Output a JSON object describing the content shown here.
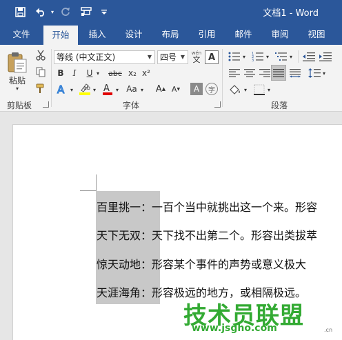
{
  "window": {
    "title": "文档1 - Word"
  },
  "quick_access": {
    "save_icon": "save-icon",
    "undo_icon": "undo-icon",
    "redo_icon": "redo-icon",
    "touch_mode_icon": "touch-mode-icon",
    "customize_icon": "customize-icon"
  },
  "tabs": [
    {
      "label": "文件"
    },
    {
      "label": "开始"
    },
    {
      "label": "插入"
    },
    {
      "label": "设计"
    },
    {
      "label": "布局"
    },
    {
      "label": "引用"
    },
    {
      "label": "邮件"
    },
    {
      "label": "审阅"
    },
    {
      "label": "视图"
    }
  ],
  "active_tab": "开始",
  "ribbon": {
    "clipboard": {
      "paste_label": "粘贴",
      "group_label": "剪贴板"
    },
    "font": {
      "font_name": "等线 (中文正文)",
      "font_size": "四号",
      "wen_label": "wén",
      "bold": "B",
      "italic": "I",
      "underline": "U",
      "strikethrough": "abc",
      "subscript": "x₂",
      "superscript": "x²",
      "change_case": "Aa",
      "grow_font": "A",
      "shrink_font": "A",
      "char_border": "A",
      "char_shading": "A",
      "enclose": "字",
      "group_label": "字体"
    },
    "paragraph": {
      "group_label": "段落"
    }
  },
  "document": {
    "lines": [
      {
        "term": "百里挑一",
        "sep": "：",
        "def": "一百个当中就挑出这一个来。形容"
      },
      {
        "term": "天下无双",
        "sep": "：",
        "def": "天下找不出第二个。形容出类拔萃"
      },
      {
        "term": "惊天动地",
        "sep": "：",
        "def": "形容某个事件的声势或意义极大"
      },
      {
        "term": "天涯海角",
        "sep": "：",
        "def": "形容极远的地方，或相隔极远。"
      }
    ]
  },
  "watermark": {
    "main": "技术员联盟",
    "url": "www.jsgho.com",
    "suffix": ".cn"
  },
  "colors": {
    "brand": "#2b579a",
    "ribbon_bg": "#f3f3f3",
    "selection": "#c8c8c8",
    "highlight_yellow": "#ffff00",
    "font_red": "#e00000",
    "watermark_green": "#33aa33"
  }
}
